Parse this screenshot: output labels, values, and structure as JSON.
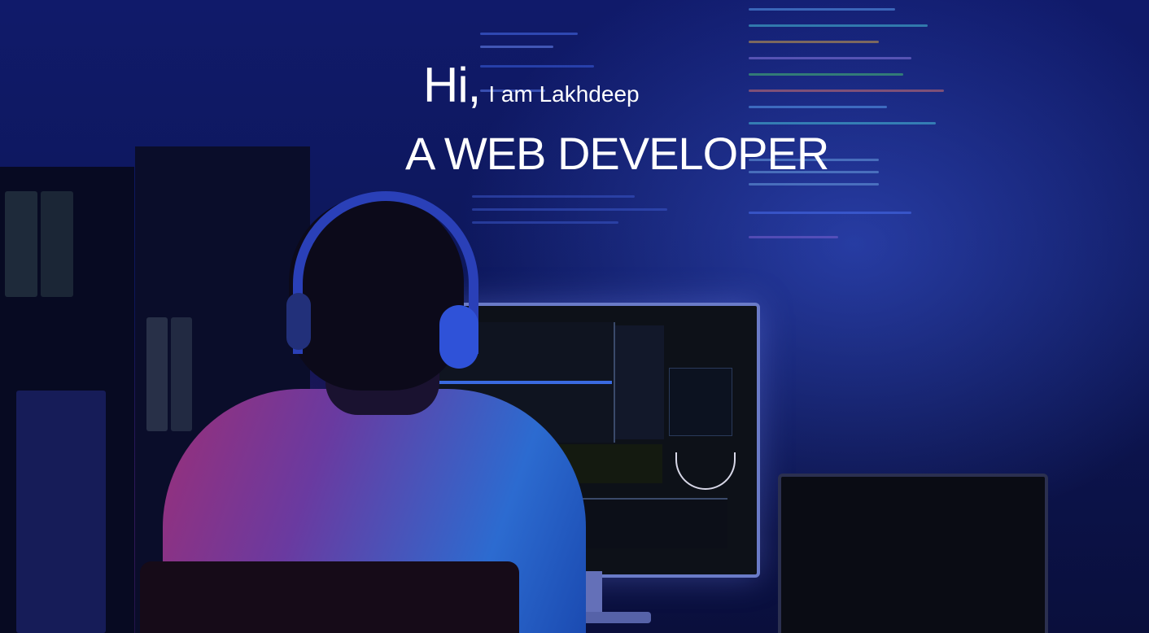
{
  "hero": {
    "greeting_hi": "Hi,",
    "greeting_name": "I am Lakhdeep",
    "role": "A WEB DEVELOPER"
  },
  "colors": {
    "background": "#101a6a",
    "text": "#ffffff",
    "accent_blue": "#2f52d8",
    "accent_magenta": "#9a2f78"
  }
}
